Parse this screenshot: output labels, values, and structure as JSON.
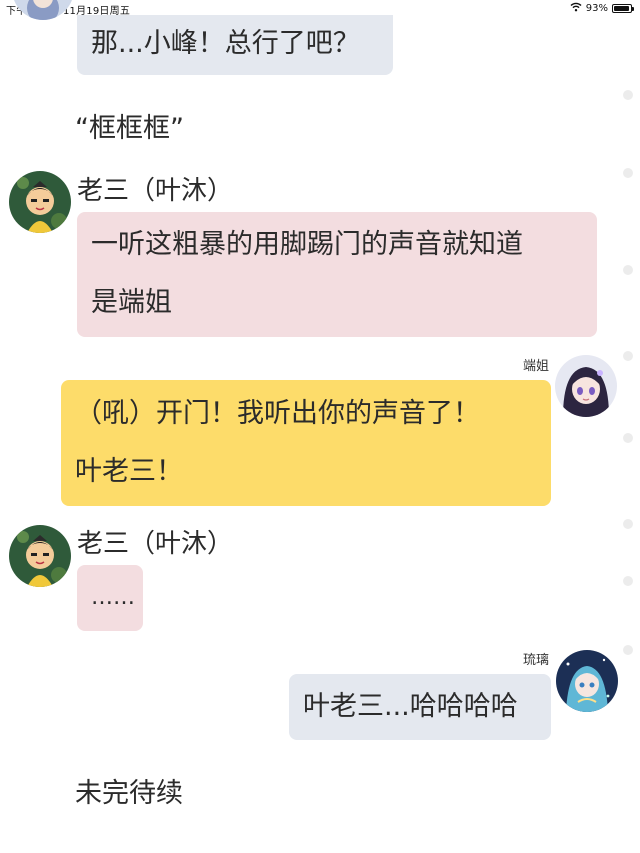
{
  "status_bar": {
    "time": "下午10:07",
    "date": "11月19日周五",
    "battery": "93%",
    "battery_level": 0.93
  },
  "messages": [
    {
      "speaker": "",
      "text": "那...小峰！总行了吧？"
    },
    {
      "narration": "“框框框”"
    },
    {
      "speaker": "老三（叶沐）",
      "text_lines": [
        "一听这粗暴的用脚踢门的声音就知道",
        "是端姐"
      ]
    },
    {
      "speaker": "端姐",
      "text_lines": [
        "（吼）开门！我听出你的声音了！",
        "叶老三！"
      ]
    },
    {
      "speaker": "老三（叶沐）",
      "text": "……"
    },
    {
      "speaker": "琉璃",
      "text": "叶老三...哈哈哈哈"
    },
    {
      "narration": "未完待续"
    }
  ],
  "colors": {
    "grey_bubble": "#e4e8ef",
    "pink_bubble": "#f3dde0",
    "yellow_bubble": "#fddc6a"
  },
  "icons": {
    "wifi": "wifi-icon",
    "battery": "battery-icon"
  }
}
